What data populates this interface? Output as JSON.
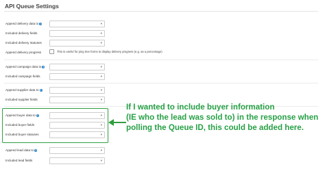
{
  "page": {
    "title": "API Queue Settings"
  },
  "groups": {
    "delivery": {
      "data_to_label": "Append delivery data to",
      "fields_label": "Included delivery fields",
      "statuses_label": "Included delivery statuses",
      "progress_label": "Append delivery progress",
      "progress_hint": "This is useful for ping tree forms to display delivery progress (e.g. as a percentage)"
    },
    "campaign": {
      "data_to_label": "Append campaign data to",
      "fields_label": "Included campaign fields"
    },
    "supplier": {
      "data_to_label": "Append supplier data to",
      "fields_label": "Included supplier fields"
    },
    "buyer": {
      "data_to_label": "Append buyer data to",
      "fields_label": "Included buyer fields",
      "statuses_label": "Included buyer statuses"
    },
    "lead": {
      "data_to_label": "Append lead data to",
      "fields_label": "Included lead fields"
    }
  },
  "icons": {
    "info": "info-icon",
    "dropdown": "chevron-down-icon"
  },
  "annotation": {
    "text": "If I wanted to include buyer information\n(IE who the lead was sold to) in the response when\npolling the Queue ID, this could be added here.",
    "color": "#27a046"
  }
}
